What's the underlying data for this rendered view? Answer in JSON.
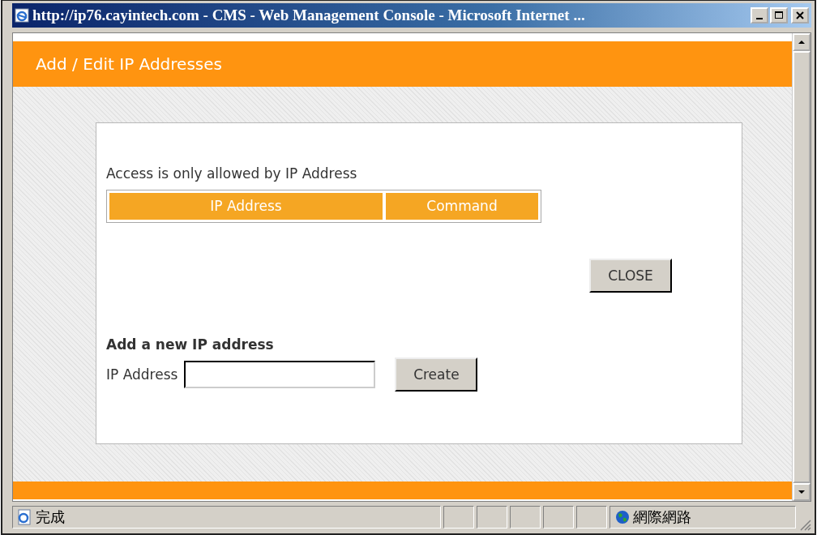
{
  "window": {
    "title": "http://ip76.cayintech.com - CMS - Web Management Console - Microsoft Internet ..."
  },
  "page": {
    "header": "Add / Edit IP Addresses",
    "intro": "Access is only allowed by IP Address",
    "table": {
      "columns": [
        "IP Address",
        "Command"
      ]
    },
    "close_button": "CLOSE",
    "add_form": {
      "heading": "Add a new IP address",
      "label": "IP Address",
      "button": "Create"
    }
  },
  "status_bar": {
    "text": "完成",
    "zone": "網際網路"
  }
}
